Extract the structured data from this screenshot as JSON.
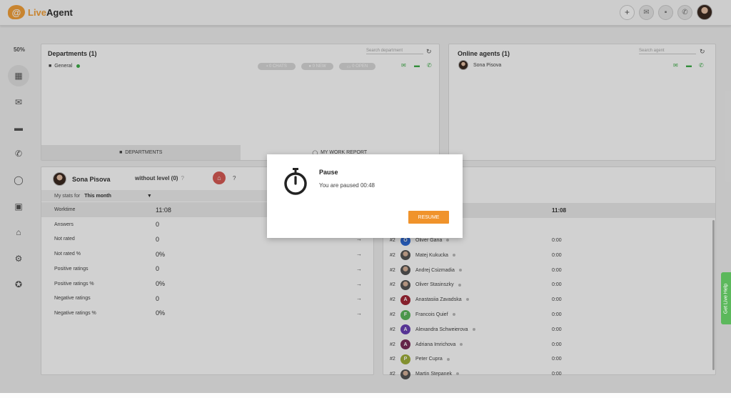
{
  "app": {
    "logo_mark": "@",
    "logo_live": "Live",
    "logo_agent": "Agent"
  },
  "topbar": {
    "icons": [
      "plus-icon",
      "mail-icon",
      "chat-icon",
      "phone-icon"
    ]
  },
  "nav": {
    "percent": "50%",
    "items": [
      "dashboard-icon",
      "mail-icon",
      "chat-icon",
      "phone-icon",
      "circle-icon",
      "contacts-icon",
      "bank-icon",
      "gear-icon",
      "star-icon"
    ]
  },
  "departments": {
    "title": "Departments (1)",
    "search_placeholder": "Search department",
    "row_name": "General",
    "pills": [
      "0 CHATS",
      "0 NEW",
      "0 OPEN"
    ],
    "tabs": [
      "DEPARTMENTS",
      "MY WORK REPORT"
    ]
  },
  "online_agents": {
    "title": "Online agents (1)",
    "search_placeholder": "Search agent",
    "agent_name": "Sona Pisova"
  },
  "stats": {
    "agent_name": "Sona Pisova",
    "level": "without level (0)",
    "level_help": "?",
    "badge_help": "?",
    "filter_label": "My stats for",
    "filter_value": "This month",
    "rows": [
      {
        "label": "Worktime",
        "value": "11:08"
      },
      {
        "label": "Answers",
        "value": "0"
      },
      {
        "label": "Not rated",
        "value": "0"
      },
      {
        "label": "Not rated %",
        "value": "0%"
      },
      {
        "label": "Positive ratings",
        "value": "0"
      },
      {
        "label": "Positive ratings %",
        "value": "0%"
      },
      {
        "label": "Negative ratings",
        "value": "0"
      },
      {
        "label": "Negative ratings %",
        "value": "0%"
      }
    ]
  },
  "leaderboard": {
    "top_time": "11:08",
    "rows": [
      {
        "rank": "#2",
        "initial": "O",
        "color": "#2e6bd6",
        "name": "Oliver Gana",
        "time": "0:00"
      },
      {
        "rank": "#2",
        "initial": "",
        "color": "",
        "name": "Matej Kukucka",
        "time": "0:00"
      },
      {
        "rank": "#2",
        "initial": "",
        "color": "",
        "name": "Andrej Csizmadia",
        "time": "0:00"
      },
      {
        "rank": "#2",
        "initial": "",
        "color": "",
        "name": "Oliver Stasinszky",
        "time": "0:00"
      },
      {
        "rank": "#2",
        "initial": "A",
        "color": "#a32636",
        "name": "Anastasiia Zavadska",
        "time": "0:00"
      },
      {
        "rank": "#2",
        "initial": "F",
        "color": "#5cb85c",
        "name": "Francois Quief",
        "time": "0:00"
      },
      {
        "rank": "#2",
        "initial": "A",
        "color": "#6a3fb5",
        "name": "Alexandra Schweierova",
        "time": "0:00"
      },
      {
        "rank": "#2",
        "initial": "A",
        "color": "#7a2d5a",
        "name": "Adriana Imrichova",
        "time": "0:00"
      },
      {
        "rank": "#2",
        "initial": "P",
        "color": "#9fb03a",
        "name": "Peter Cupra",
        "time": "0:00"
      },
      {
        "rank": "#2",
        "initial": "",
        "color": "",
        "name": "Martin Stepanek",
        "time": "0:00"
      }
    ]
  },
  "help_tab": "Get Live Help",
  "modal": {
    "title": "Pause",
    "text": "You are paused 00:48",
    "button": "RESUME",
    "button_color": "#f0932b"
  }
}
